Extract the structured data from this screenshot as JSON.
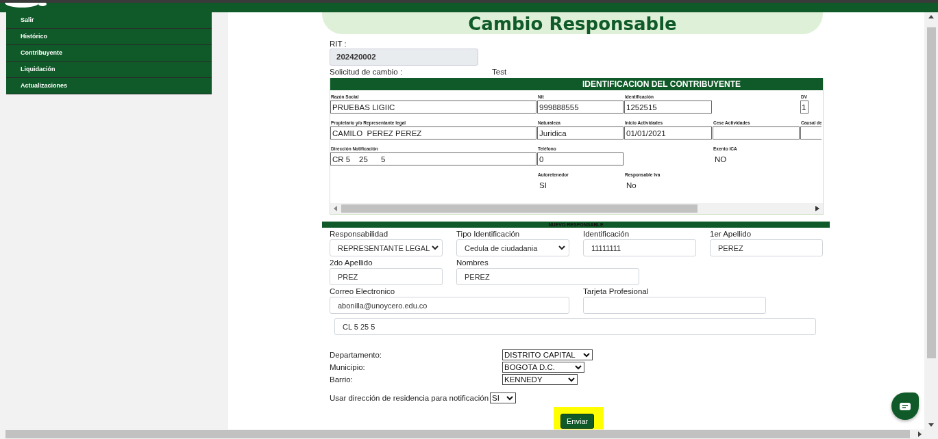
{
  "sidebar": {
    "items": [
      {
        "label": "Salir"
      },
      {
        "label": "Histórico"
      },
      {
        "label": "Contribuyente"
      },
      {
        "label": "Liquidación"
      },
      {
        "label": "Actualizaciones"
      }
    ]
  },
  "title": "Cambio Responsable",
  "rit": {
    "label": "RIT :",
    "value": "202420002"
  },
  "request": {
    "label": "Solicitud de cambio :",
    "value": "Test"
  },
  "contributor": {
    "title": "IDENTIFICACION DEL CONTRIBUYENTE",
    "rows": [
      [
        {
          "kind": "input",
          "label": "Razón Social",
          "value": "PRUEBAS LIGIIC"
        },
        {
          "kind": "input",
          "label": "Nit",
          "value": "999888555"
        },
        {
          "kind": "input",
          "label": "Identificación",
          "value": "1252515"
        },
        {
          "kind": "blank"
        },
        {
          "kind": "small",
          "label": "DV",
          "value": "1"
        }
      ],
      [
        {
          "kind": "input",
          "label": "Propietario y/o Representante legal",
          "value": "CAMILO  PEREZ PEREZ"
        },
        {
          "kind": "input",
          "label": "Naturaleza",
          "value": "Juridica"
        },
        {
          "kind": "input",
          "label": "Inicio Actividades",
          "value": "01/01/2021"
        },
        {
          "kind": "input",
          "label": "Cese Actividades"
        },
        {
          "kind": "input",
          "label": "Causal de"
        }
      ],
      [
        {
          "kind": "input",
          "label": "Dirección Notificación",
          "value": "CR 5    25      5"
        },
        {
          "kind": "input",
          "label": "Teléfono",
          "value": "0"
        },
        {
          "kind": "blank"
        },
        {
          "kind": "text",
          "label": "Exento ICA",
          "value": "NO"
        },
        {
          "kind": "blank"
        }
      ],
      [
        {
          "kind": "blank"
        },
        {
          "kind": "text",
          "label": "Autoretenedor",
          "value": "SI"
        },
        {
          "kind": "text",
          "label": "Responsable Iva",
          "value": "No"
        },
        {
          "kind": "blank"
        },
        {
          "kind": "blank"
        }
      ]
    ]
  },
  "new_responsible": {
    "title": "NUEVO RESPONSABLE",
    "fields": [
      {
        "kind": "select",
        "label": "Responsabilidad",
        "value": "REPRESENTANTE LEGAL"
      },
      {
        "kind": "select",
        "label": "Tipo Identificación",
        "value": "Cedula de ciudadania"
      },
      {
        "kind": "input",
        "label": "Identificación",
        "value": "11111111"
      },
      {
        "kind": "input",
        "label": "1er Apellido",
        "value": "PEREZ"
      },
      {
        "kind": "input",
        "label": "2do Apellido",
        "value": "PREZ"
      },
      {
        "kind": "input",
        "label": "Nombres",
        "value": "PEREZ"
      },
      {
        "kind": "input",
        "label": "Correo Electronico",
        "value": "abonilla@unoycero.edu.co"
      },
      {
        "kind": "input",
        "label": "Tarjeta Profesional"
      },
      {
        "kind": "input",
        "value": "CL 5 25 5"
      }
    ]
  },
  "location": [
    {
      "label": "Departamento:",
      "value": "DISTRITO CAPITAL"
    },
    {
      "label": "Municipio:",
      "value": "BOGOTA D.C."
    },
    {
      "label": "Barrio:",
      "value": "KENNEDY"
    }
  ],
  "notification": {
    "label": "Usar dirección de residencia para notificación",
    "value": "SI"
  },
  "submit": "Enviar"
}
